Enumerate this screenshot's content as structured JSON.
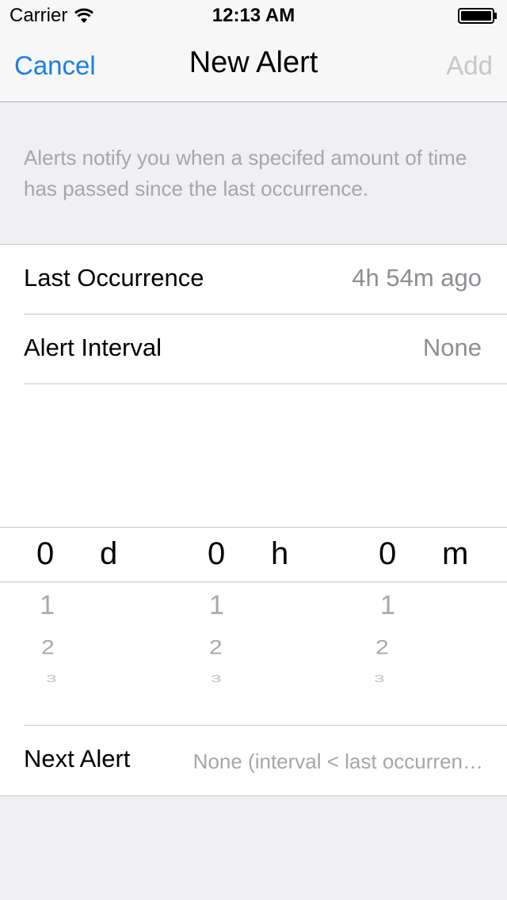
{
  "status_bar": {
    "carrier": "Carrier",
    "time": "12:13 AM",
    "wifi_icon": "wifi-icon",
    "battery_icon": "battery-icon"
  },
  "nav": {
    "cancel_label": "Cancel",
    "title": "New Alert",
    "add_label": "Add"
  },
  "description": "Alerts notify you when a specifed amount of time has passed since the last occurrence.",
  "cells": {
    "last_occurrence": {
      "label": "Last Occurrence",
      "value": "4h 54m ago"
    },
    "alert_interval": {
      "label": "Alert Interval",
      "value": "None"
    },
    "next_alert": {
      "label": "Next Alert",
      "value": "None (interval < last occurren…"
    }
  },
  "picker": {
    "days": {
      "selected": "0",
      "unit": "d",
      "options": [
        "1",
        "2",
        "3"
      ]
    },
    "hours": {
      "selected": "0",
      "unit": "h",
      "options": [
        "1",
        "2",
        "3"
      ]
    },
    "minutes": {
      "selected": "0",
      "unit": "m",
      "options": [
        "1",
        "2",
        "3"
      ]
    }
  },
  "colors": {
    "accent": "#1a7ee8",
    "disabled": "#c7c7cc",
    "secondary_text": "#8e8e93",
    "background": "#efeff4"
  }
}
